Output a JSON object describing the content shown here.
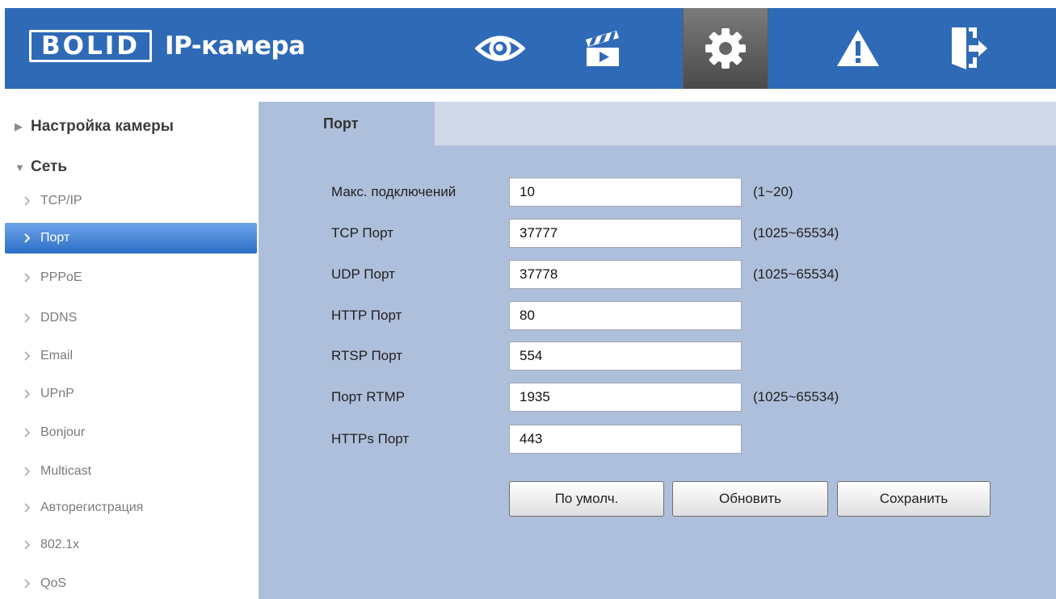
{
  "header": {
    "logo_text": "BOLID",
    "title": "IP-камера",
    "nav": [
      {
        "icon": "eye-icon",
        "active": false
      },
      {
        "icon": "video-playback-icon",
        "active": false
      },
      {
        "icon": "gear-icon",
        "active": true
      },
      {
        "icon": "warning-icon",
        "active": false
      },
      {
        "icon": "logout-icon",
        "active": false
      }
    ]
  },
  "sidebar": {
    "sections": [
      {
        "label": "Настройка камеры",
        "expanded": false
      },
      {
        "label": "Сеть",
        "expanded": true
      }
    ],
    "items": [
      {
        "label": "TCP/IP"
      },
      {
        "label": "Порт",
        "active": true
      },
      {
        "label": "PPPoE"
      },
      {
        "label": "DDNS"
      },
      {
        "label": "Email"
      },
      {
        "label": "UPnP"
      },
      {
        "label": "Bonjour"
      },
      {
        "label": "Multicast"
      },
      {
        "label": "Авторегистрация"
      },
      {
        "label": "802.1x"
      },
      {
        "label": "QoS"
      }
    ]
  },
  "main": {
    "tab": "Порт",
    "fields": [
      {
        "label": "Макс. подключений",
        "value": "10",
        "range": "(1~20)"
      },
      {
        "label": "TCP Порт",
        "value": "37777",
        "range": "(1025~65534)"
      },
      {
        "label": "UDP Порт",
        "value": "37778",
        "range": "(1025~65534)"
      },
      {
        "label": "HTTP Порт",
        "value": "80",
        "range": ""
      },
      {
        "label": "RTSP Порт",
        "value": "554",
        "range": ""
      },
      {
        "label": "Порт RTMP",
        "value": "1935",
        "range": "(1025~65534)"
      },
      {
        "label": "HTTPs Порт",
        "value": "443",
        "range": ""
      }
    ],
    "buttons": {
      "default": "По умолч.",
      "refresh": "Обновить",
      "save": "Сохранить"
    }
  },
  "colors": {
    "header_bg": "#2f6ab7",
    "content_bg": "#aebfdb",
    "active_item": "#2b6fc9"
  }
}
